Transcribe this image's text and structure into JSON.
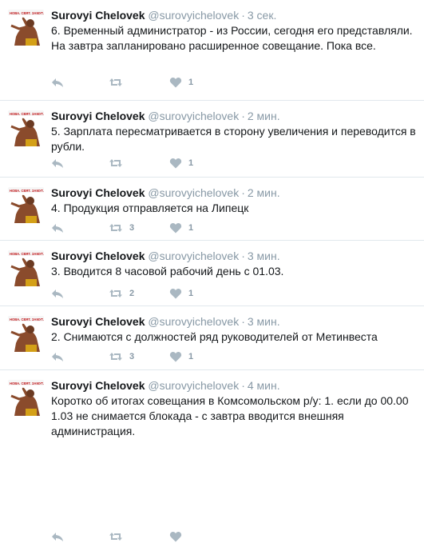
{
  "tweets": [
    {
      "name": "Surovyi Chelovek",
      "handle": "@surovyichelovek",
      "time": "3 сек.",
      "text": "6. Временный администратор - из России, сегодня его представляли. На завтра запланировано расширенное совещание. Пока все.",
      "retweets": "",
      "likes": "1"
    },
    {
      "name": "Surovyi Chelovek",
      "handle": "@surovyichelovek",
      "time": "2 мин.",
      "text": "5. Зарплата пересматривается в сторону увеличения и переводится в рубли.",
      "retweets": "",
      "likes": "1"
    },
    {
      "name": "Surovyi Chelovek",
      "handle": "@surovyichelovek",
      "time": "2 мин.",
      "text": "4. Продукция отправляется на Липецк",
      "retweets": "3",
      "likes": "1"
    },
    {
      "name": "Surovyi Chelovek",
      "handle": "@surovyichelovek",
      "time": "3 мин.",
      "text": "3. Вводится 8 часовой рабочий день с 01.03.",
      "retweets": "2",
      "likes": "1"
    },
    {
      "name": "Surovyi Chelovek",
      "handle": "@surovyichelovek",
      "time": "3 мин.",
      "text": "2. Снимаются с должностей ряд руководителей от Метинвеста",
      "retweets": "3",
      "likes": "1"
    },
    {
      "name": "Surovyi Chelovek",
      "handle": "@surovyichelovek",
      "time": "4 мин.",
      "text": "Коротко об итогах совещания в Комсомольском р/у: 1. если до 00.00 1.03 не снимается блокада - с завтра вводится внешняя администрация.",
      "retweets": "",
      "likes": ""
    }
  ],
  "colors": {
    "text": "#14171a",
    "muted": "#8899a6",
    "divider": "#e1e8ed"
  },
  "icons": [
    "reply-icon",
    "retweet-icon",
    "like-icon"
  ]
}
